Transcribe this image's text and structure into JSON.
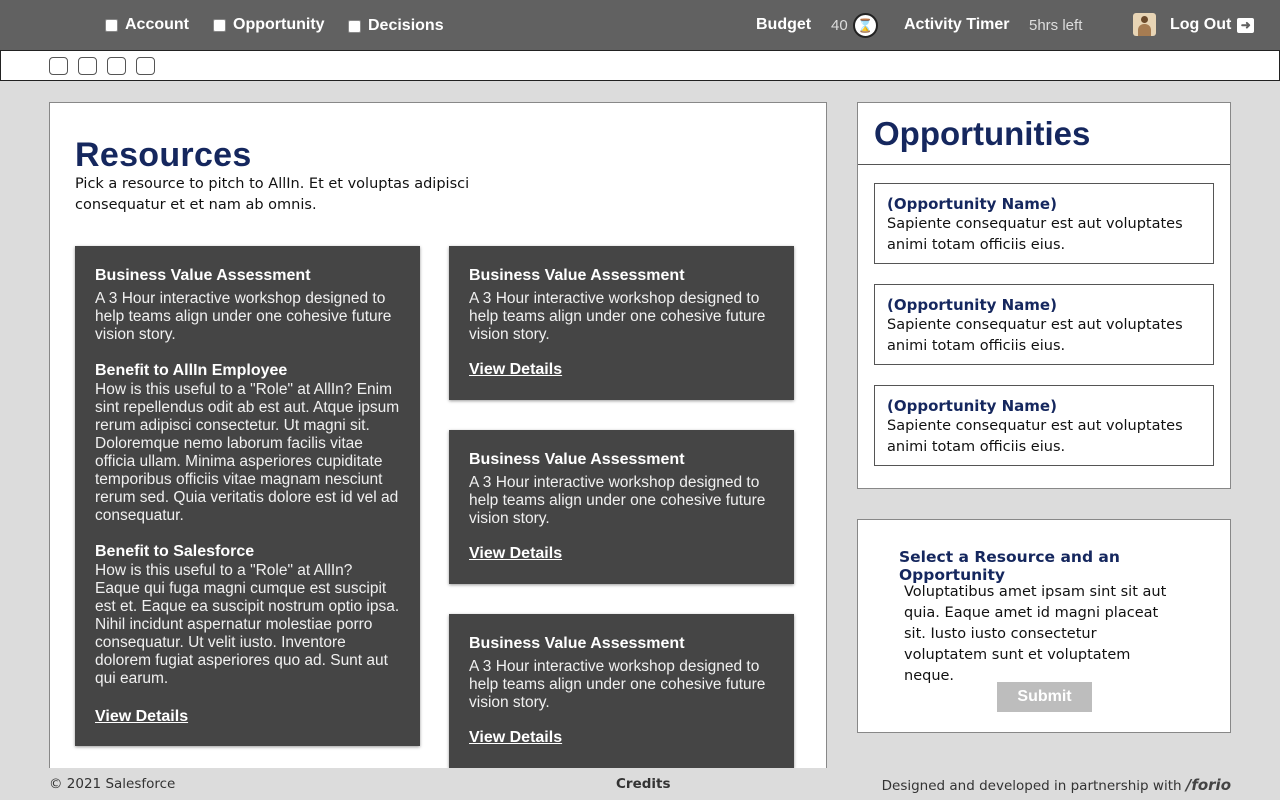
{
  "nav": {
    "tabs": [
      {
        "label": "Account"
      },
      {
        "label": "Opportunity"
      },
      {
        "label": "Decisions"
      }
    ],
    "budget_label": "Budget",
    "budget_value": "40",
    "timer_label": "Activity Timer",
    "timer_value": "5hrs left",
    "logout_label": "Log Out"
  },
  "resources": {
    "title": "Resources",
    "description": "Pick a resource to pitch to AllIn. Et et voluptas adipisci consequatur et et nam ab omnis.",
    "featured": {
      "title": "Business Value Assessment",
      "description": "A 3 Hour interactive workshop designed to help teams align under one cohesive future vision story.",
      "benefit_employee_title": "Benefit to AllIn Employee",
      "benefit_employee_text": "How is this useful to a \"Role\" at AllIn? Enim sint repellendus odit ab est aut. Atque ipsum rerum adipisci consectetur. Ut magni sit. Doloremque nemo laborum facilis vitae officia ullam. Minima asperiores cupiditate temporibus officiis vitae magnam nesciunt rerum sed. Quia veritatis dolore est id vel ad consequatur.",
      "benefit_salesforce_title": "Benefit to Salesforce",
      "benefit_salesforce_text": "How is this useful to a \"Role\" at AllIn? Eaque qui fuga magni cumque est suscipit est et. Eaque ea suscipit nostrum optio ipsa. Nihil incidunt aspernatur molestiae porro consequatur. Ut velit iusto. Inventore dolorem fugiat asperiores quo ad. Sunt aut qui earum.",
      "link": "View Details"
    },
    "cards": [
      {
        "title": "Business Value Assessment",
        "description": "A 3 Hour interactive workshop designed to help teams align under one cohesive future vision story.",
        "link": "View Details"
      },
      {
        "title": "Business Value Assessment",
        "description": "A 3 Hour interactive workshop designed to help teams align under one cohesive future vision story.",
        "link": "View Details"
      },
      {
        "title": "Business Value Assessment",
        "description": "A 3 Hour interactive workshop designed to help teams align under one cohesive future vision story.",
        "link": "View Details"
      }
    ]
  },
  "opportunities": {
    "title": "Opportunities",
    "items": [
      {
        "name": "(Opportunity Name)",
        "description": "Sapiente consequatur est aut voluptates animi totam officiis eius."
      },
      {
        "name": "(Opportunity Name)",
        "description": "Sapiente consequatur est aut voluptates animi totam officiis eius."
      },
      {
        "name": "(Opportunity Name)",
        "description": "Sapiente consequatur est aut voluptates animi totam officiis eius."
      }
    ]
  },
  "select_panel": {
    "title": "Select a Resource and an Opportunity",
    "description": "Voluptatibus amet ipsam sint sit aut quia. Eaque amet id magni placeat sit. Iusto iusto consectetur voluptatem sunt et voluptatem neque.",
    "submit_label": "Submit"
  },
  "footer": {
    "copyright": "© 2021 Salesforce",
    "credits": "Credits",
    "designed_by": "Designed and developed in partnership with",
    "partner": "/forio"
  },
  "colors": {
    "topbar": "#616161",
    "card": "#454545",
    "heading_navy": "#15275e",
    "submit_disabled": "#bdbdbd"
  },
  "icons": [
    "checkbox-icon",
    "hourglass-icon",
    "avatar",
    "logout-arrow-icon"
  ]
}
